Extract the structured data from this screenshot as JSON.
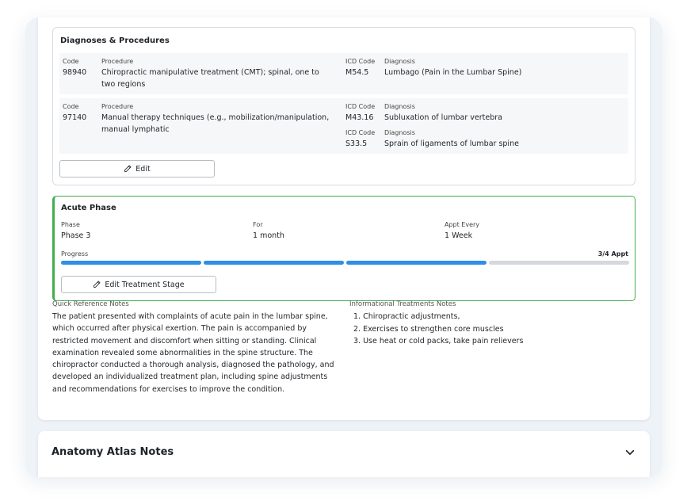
{
  "diagnoses": {
    "title": "Diagnoses & Procedures",
    "rows": [
      {
        "code_label": "Code",
        "code": "98940",
        "procedure_label": "Procedure",
        "procedure": "Chiropractic manipulative treatment (CMT); spinal, one to two regions",
        "diagnoses": [
          {
            "icd_label": "ICD Code",
            "icd": "M54.5",
            "diagnosis_label": "Diagnosis",
            "diagnosis": "Lumbago (Pain in the Lumbar Spine)"
          }
        ]
      },
      {
        "code_label": "Code",
        "code": "97140",
        "procedure_label": "Procedure",
        "procedure": "Manual therapy techniques (e.g., mobilization/manipulation, manual lymphatic",
        "diagnoses": [
          {
            "icd_label": "ICD Code",
            "icd": "M43.16",
            "diagnosis_label": "Diagnosis",
            "diagnosis": "Subluxation of lumbar vertebra"
          },
          {
            "icd_label": "ICD Code",
            "icd": "S33.5",
            "diagnosis_label": "Diagnosis",
            "diagnosis": "Sprain of ligaments of lumbar spine"
          }
        ]
      }
    ],
    "edit_label": "Edit"
  },
  "phase": {
    "title": "Acute Phase",
    "phase_label": "Phase",
    "phase_value": "Phase 3",
    "for_label": "For",
    "for_value": "1 month",
    "appt_label": "Appt Every",
    "appt_value": "1 Week",
    "progress_label": "Progress",
    "progress_text": "3/4 Appt",
    "progress_done": 3,
    "progress_total": 4,
    "edit_label": "Edit Treatment Stage",
    "accent_color": "#3fae4f",
    "progress_color": "#2d8fe6"
  },
  "notes": {
    "quick_label": "Quick Reference Notes",
    "quick_text": "The patient presented with complaints of acute pain in the lumbar spine, which occurred after physical exertion. The pain is accompanied by restricted movement and discomfort when sitting or standing. Clinical examination revealed some abnormalities in the spine structure. The chiropractor conducted a thorough analysis, diagnosed the pathology, and developed an individualized treatment plan, including spine adjustments and recommendations for exercises to improve the condition.",
    "info_label": "Informational Treatments Notes",
    "info_items": [
      "Chiropractic adjustments,",
      "Exercises to strengthen core muscles",
      "Use heat or cold packs, take pain relievers"
    ]
  },
  "atlas": {
    "title": "Anatomy Atlas Notes",
    "icon": "chevron-down-icon"
  }
}
